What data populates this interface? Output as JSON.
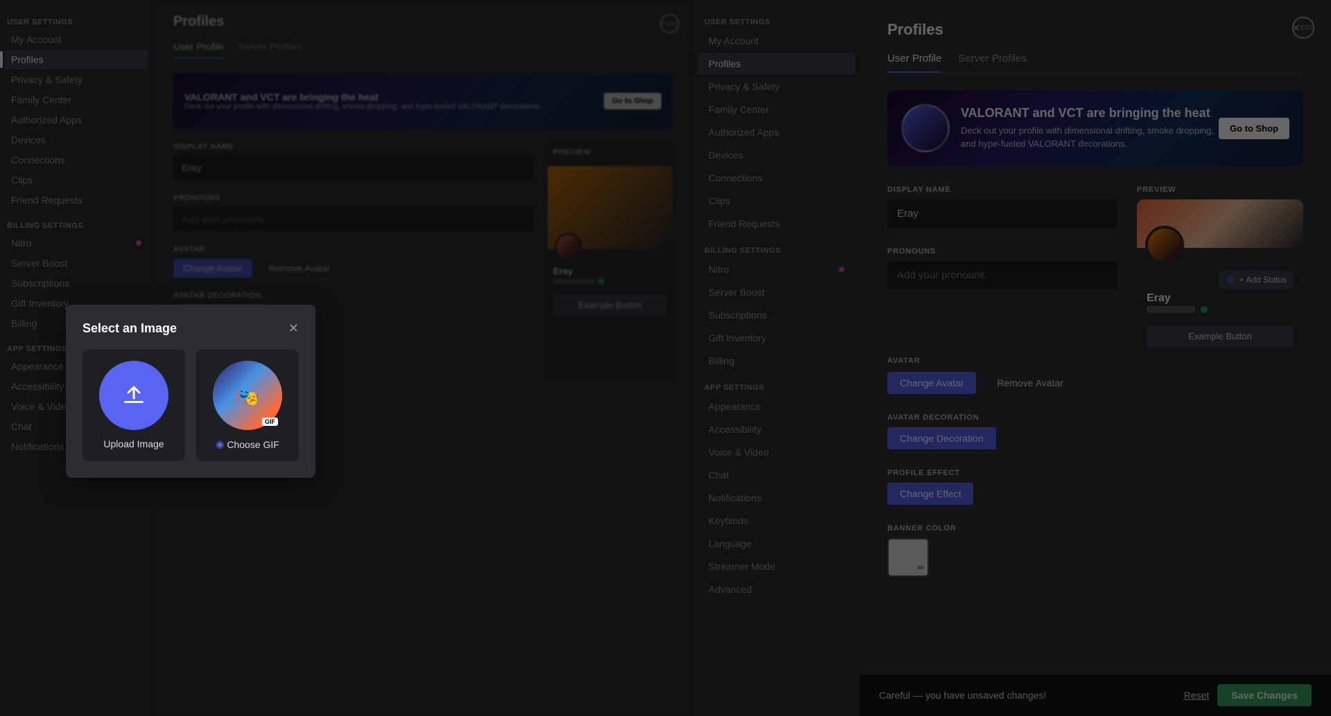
{
  "leftSidebar": {
    "sections": [
      {
        "label": "USER SETTINGS",
        "items": [
          {
            "id": "my-account",
            "label": "My Account",
            "active": false
          },
          {
            "id": "profiles",
            "label": "Profiles",
            "active": true
          },
          {
            "id": "privacy-safety",
            "label": "Privacy & Safety",
            "active": false
          },
          {
            "id": "family-center",
            "label": "Family Center",
            "active": false
          },
          {
            "id": "authorized-apps",
            "label": "Authorized Apps",
            "active": false
          },
          {
            "id": "devices",
            "label": "Devices",
            "active": false
          },
          {
            "id": "connections",
            "label": "Connections",
            "active": false
          },
          {
            "id": "clips",
            "label": "Clips",
            "active": false
          },
          {
            "id": "friend-requests",
            "label": "Friend Requests",
            "active": false
          }
        ]
      },
      {
        "label": "BILLING SETTINGS",
        "items": [
          {
            "id": "nitro",
            "label": "Nitro",
            "active": false,
            "dot": true
          },
          {
            "id": "server-boost",
            "label": "Server Boost",
            "active": false
          },
          {
            "id": "subscriptions",
            "label": "Subscriptions",
            "active": false
          },
          {
            "id": "gift-inventory",
            "label": "Gift Inventory",
            "active": false
          },
          {
            "id": "billing",
            "label": "Billing",
            "active": false
          }
        ]
      },
      {
        "label": "APP SETTINGS",
        "items": [
          {
            "id": "appearance",
            "label": "Appearance",
            "active": false
          },
          {
            "id": "accessibility",
            "label": "Accessibility",
            "active": false
          },
          {
            "id": "voice-video",
            "label": "Voice & Video",
            "active": false
          },
          {
            "id": "chat",
            "label": "Chat",
            "active": false
          },
          {
            "id": "notifications",
            "label": "Notifications",
            "active": false
          }
        ]
      }
    ]
  },
  "middlePanel": {
    "title": "Profiles",
    "tabs": [
      {
        "label": "User Profile",
        "active": true
      },
      {
        "label": "Server Profiles",
        "active": false
      }
    ],
    "banner": {
      "title": "VALORANT and VCT are bringing the heat",
      "description": "Deck out your profile with dimensional drifting, smoke dropping, and hype-fueled VALORANT decorations.",
      "button": "Go to Shop"
    },
    "displayName": {
      "label": "DISPLAY NAME",
      "value": "Eray"
    },
    "pronouns": {
      "label": "PRONOUNS",
      "placeholder": "Add your pronouns"
    },
    "avatar": {
      "label": "AVATAR",
      "changeButton": "Change Avatar",
      "removeButton": "Remove Avatar"
    },
    "avatarDecoration": {
      "label": "AVATAR DECORATION",
      "changeButton": "Change Decoration"
    },
    "profileEffect": {
      "label": "PROFILE EFFECT",
      "changeButton": "Change Effect"
    },
    "preview": {
      "label": "PREVIEW"
    },
    "exampleButton": "Example Button"
  },
  "centerNav": {
    "sections": [
      {
        "label": "USER SETTINGS",
        "items": [
          {
            "id": "my-account",
            "label": "My Account",
            "active": false
          },
          {
            "id": "profiles",
            "label": "Profiles",
            "active": true
          },
          {
            "id": "privacy-safety",
            "label": "Privacy & Safety",
            "active": false
          },
          {
            "id": "family-center",
            "label": "Family Center",
            "active": false
          },
          {
            "id": "authorized-apps",
            "label": "Authorized Apps",
            "active": false
          },
          {
            "id": "devices",
            "label": "Devices",
            "active": false
          },
          {
            "id": "connections",
            "label": "Connections",
            "active": false
          },
          {
            "id": "clips",
            "label": "Clips",
            "active": false
          },
          {
            "id": "friend-requests",
            "label": "Friend Requests",
            "active": false
          }
        ]
      },
      {
        "label": "BILLING SETTINGS",
        "items": [
          {
            "id": "nitro",
            "label": "Nitro",
            "active": false,
            "dot": true
          },
          {
            "id": "server-boost",
            "label": "Server Boost",
            "active": false
          },
          {
            "id": "subscriptions",
            "label": "Subscriptions",
            "active": false
          },
          {
            "id": "gift-inventory",
            "label": "Gift Inventory",
            "active": false
          },
          {
            "id": "billing",
            "label": "Billing",
            "active": false
          }
        ]
      },
      {
        "label": "APP SETTINGS",
        "items": [
          {
            "id": "appearance",
            "label": "Appearance",
            "active": false
          },
          {
            "id": "accessibility",
            "label": "Accessibility",
            "active": false
          },
          {
            "id": "voice-video",
            "label": "Voice & Video",
            "active": false
          },
          {
            "id": "chat",
            "label": "Chat",
            "active": false
          },
          {
            "id": "notifications",
            "label": "Notifications",
            "active": false
          },
          {
            "id": "keybinds",
            "label": "Keybinds",
            "active": false
          },
          {
            "id": "language",
            "label": "Language",
            "active": false
          },
          {
            "id": "streamer-mode",
            "label": "Streamer Mode",
            "active": false
          },
          {
            "id": "advanced",
            "label": "Advanced",
            "active": false
          }
        ]
      }
    ]
  },
  "rightPanel": {
    "title": "Profiles",
    "tabs": [
      {
        "label": "User Profile",
        "active": true
      },
      {
        "label": "Server Profiles",
        "active": false
      }
    ],
    "banner": {
      "title": "VALORANT and VCT are bringing the heat",
      "description": "Deck out your profile with dimensional drifting, smoke dropping, and hype-fueled VALORANT decorations.",
      "button": "Go to Shop"
    },
    "displayName": {
      "label": "DISPLAY NAME",
      "value": "Eray"
    },
    "pronouns": {
      "label": "PRONOUNS",
      "placeholder": "Add your pronouns"
    },
    "preview": {
      "label": "PREVIEW"
    },
    "previewCard": {
      "username": "Eray",
      "addStatus": "+ Add Status",
      "exampleButton": "Example Button"
    },
    "avatar": {
      "label": "AVATAR",
      "changeButton": "Change Avatar",
      "removeButton": "Remove Avatar"
    },
    "avatarDecoration": {
      "label": "AVATAR DECORATION",
      "changeButton": "Change Decoration"
    },
    "profileEffect": {
      "label": "PROFILE EFFECT",
      "changeButton": "Change Effect"
    },
    "bannerColor": {
      "label": "BANNER COLOR"
    }
  },
  "modal": {
    "title": "Select an Image",
    "options": [
      {
        "id": "upload",
        "label": "Upload Image",
        "icon": "📤"
      },
      {
        "id": "gif",
        "label": "Choose GIF",
        "gif": true
      }
    ],
    "closeIcon": "✕"
  },
  "saveBar": {
    "message": "Careful — you have unsaved changes!",
    "resetButton": "Reset",
    "saveButton": "Save Changes"
  },
  "escLabel": "ESC"
}
